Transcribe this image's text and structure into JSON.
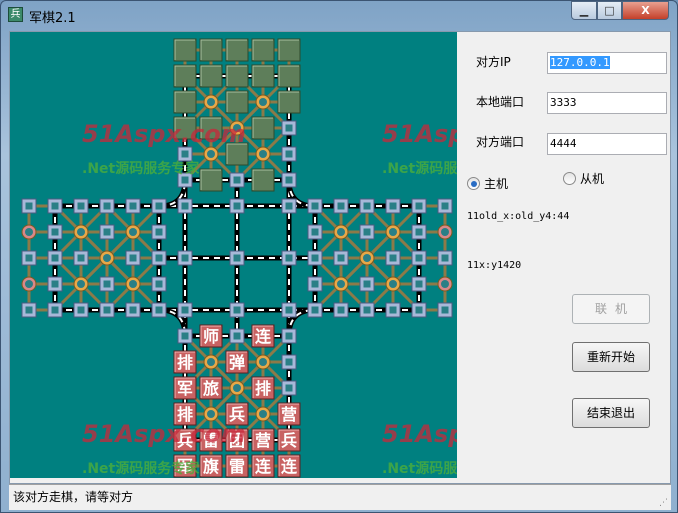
{
  "window": {
    "title": "军棋2.1",
    "icon_glyph": "兵",
    "minimize": "▁",
    "maximize": "□",
    "close": "X"
  },
  "panel": {
    "remote_ip_label": "对方IP",
    "remote_ip_value": "127.0.0.1",
    "local_port_label": "本地端口",
    "local_port_value": "3333",
    "remote_port_label": "对方端口",
    "remote_port_value": "4444",
    "radio_host": {
      "label": "主机",
      "checked": true
    },
    "radio_client": {
      "label": "从机",
      "checked": false
    },
    "debug_line1": "11old_x:old_y4:44",
    "debug_line2": "11x:y1420",
    "connect_button": "联机",
    "restart_button": "重新开始",
    "exit_button": "结束退出"
  },
  "status": {
    "text": "该对方走棋，请等对方",
    "grip": "⋰"
  },
  "watermark": {
    "logo": "51Aspx.com",
    "slogan": ".Net源码服务专家"
  },
  "colors": {
    "board": "#008080",
    "panel": "#f0f0f0",
    "hidden_piece": "#5e7e5a",
    "own_piece": "#c86262",
    "rail": "#000000",
    "road": "#8c7a48",
    "station": "#a8b8d8",
    "camp": "#e8a848",
    "hq": "#d88888"
  },
  "board": {
    "top_hidden": [
      [
        1,
        1,
        1,
        1,
        1
      ],
      [
        1,
        1,
        1,
        1,
        1
      ],
      [
        1,
        0,
        1,
        0,
        1
      ],
      [
        1,
        1,
        0,
        1,
        0
      ],
      [
        0,
        0,
        1,
        0,
        0
      ],
      [
        0,
        1,
        0,
        1,
        0
      ]
    ],
    "bottom_pieces": [
      [
        "",
        "师",
        "",
        "连",
        ""
      ],
      [
        "排",
        "",
        "弹",
        "",
        ""
      ],
      [
        "军",
        "旅",
        "",
        "排",
        ""
      ],
      [
        "排",
        "",
        "兵",
        "",
        "营"
      ],
      [
        "兵",
        "雷",
        "团",
        "营",
        "兵"
      ],
      [
        "军",
        "旗",
        "雷",
        "连",
        "连"
      ]
    ]
  }
}
